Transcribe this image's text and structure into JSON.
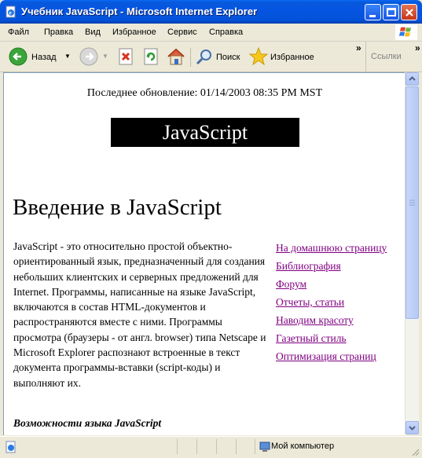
{
  "window": {
    "title": "Учебник JavaScript - Microsoft Internet Explorer"
  },
  "menu": {
    "items": [
      "Файл",
      "Правка",
      "Вид",
      "Избранное",
      "Сервис",
      "Справка"
    ]
  },
  "toolbar": {
    "back_label": "Назад",
    "search_label": "Поиск",
    "favorites_label": "Избранное",
    "links_label": "Ссылки",
    "chevron": "»"
  },
  "page": {
    "updated": "Последнее обновление: 01/14/2003 08:35 PM MST",
    "logo": "JavaScript",
    "heading": "Введение в JavaScript",
    "paragraph": "JavaScript - это относительно простой объектно-ориентированный язык, предназначенный для создания небольших клиентских и серверных предложений для Internet. Программы, написанные на языке JavaScript, включаются в состав HTML-документов и распространяются вместе с ними. Программы просмотра (браузеры - от англ. browser) типа Netscape и Microsoft Explorer распознают встроенные в текст документа программы-вставки (script-коды) и выполняют их.",
    "features_heading": "Возможности языка JavaScript",
    "nav_links": [
      "На домашнюю страницу",
      "Библиография",
      "Форум",
      "Отчеты, статьи",
      "Наводим красоту",
      "Газетный стиль",
      "Оптимизация страниц"
    ]
  },
  "status": {
    "zone": "Мой компьютер"
  },
  "colors": {
    "titlebar": "#0555E3",
    "visited_link": "#800080",
    "logo_bg": "#000000"
  }
}
